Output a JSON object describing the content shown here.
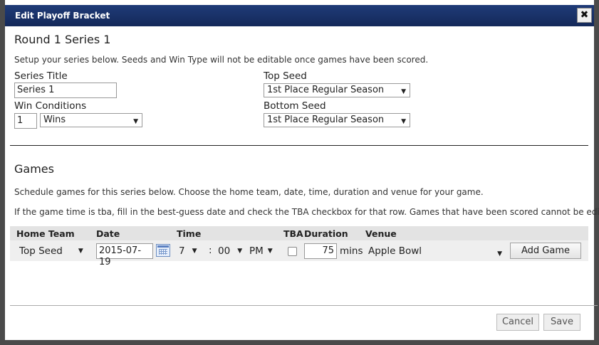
{
  "dialog": {
    "title": "Edit Playoff Bracket",
    "close_glyph": "✖"
  },
  "series": {
    "heading": "Round 1 Series 1",
    "intro": "Setup your series below. Seeds and Win Type will not be editable once games have been scored.",
    "title_label": "Series Title",
    "title_value": "Series 1",
    "win_label": "Win Conditions",
    "win_count": "1",
    "win_type": "Wins",
    "top_seed_label": "Top Seed",
    "top_seed_value": "1st Place Regular Season",
    "bottom_seed_label": "Bottom Seed",
    "bottom_seed_value": "1st Place Regular Season"
  },
  "games": {
    "heading": "Games",
    "info1": "Schedule games for this series below. Choose the home team, date, time, duration and venue for your game.",
    "info2": "If the game time is tba, fill in the best-guess date and check the TBA checkbox for that row. Games that have been scored cannot be edited.",
    "columns": [
      "Home Team",
      "Date",
      "Time",
      "TBA",
      "Duration",
      "Venue"
    ],
    "row": {
      "home_team": "Top Seed",
      "date": "2015-07-19",
      "hour": "7",
      "colon": ":",
      "minute": "00",
      "ampm": "PM",
      "tba": false,
      "duration": "75",
      "duration_unit": "mins",
      "venue": "Apple Bowl"
    },
    "add_label": "Add Game"
  },
  "footer": {
    "cancel_label": "Cancel",
    "save_label": "Save"
  },
  "icons": {
    "dropdown": "▼",
    "calendar": "calendar-icon"
  },
  "colors": {
    "titlebar": "#1f3b78",
    "header_row": "#e3e3e3",
    "body_row": "#efefef"
  }
}
